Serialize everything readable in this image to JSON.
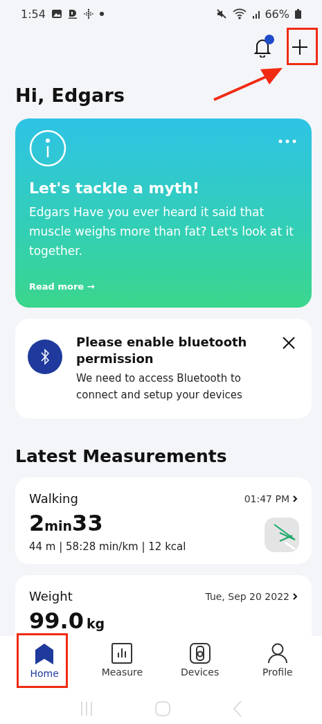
{
  "status_bar": {
    "time": "1:54",
    "battery": "66%"
  },
  "header": {
    "notifications_unread": true
  },
  "greeting": "Hi, Edgars",
  "tip_card": {
    "title": "Let's tackle a myth!",
    "body": "Edgars Have you ever heard it said that muscle weighs more than fat? Let's look at it together.",
    "link": "Read more →"
  },
  "notice": {
    "title": "Please enable bluetooth permission",
    "body": "We need to access Bluetooth to connect and setup your devices"
  },
  "section_title": "Latest Measurements",
  "measurements": [
    {
      "kind": "walking",
      "name": "Walking",
      "time": "01:47 PM",
      "value": "2$_{min}$33",
      "details": "44 m | 58:28 min/km | 12 kcal"
    },
    {
      "kind": "weight",
      "name": "Weight",
      "time": "Tue, Sep 20 2022",
      "value": "99.0",
      "unit": "kg"
    }
  ],
  "nav": [
    {
      "kind": "home",
      "label": "Home",
      "selected": true
    },
    {
      "kind": "measure",
      "label": "Measure",
      "selected": false
    },
    {
      "kind": "devices",
      "label": "Devices",
      "selected": false
    },
    {
      "kind": "profile",
      "label": "Profile",
      "selected": false
    }
  ]
}
